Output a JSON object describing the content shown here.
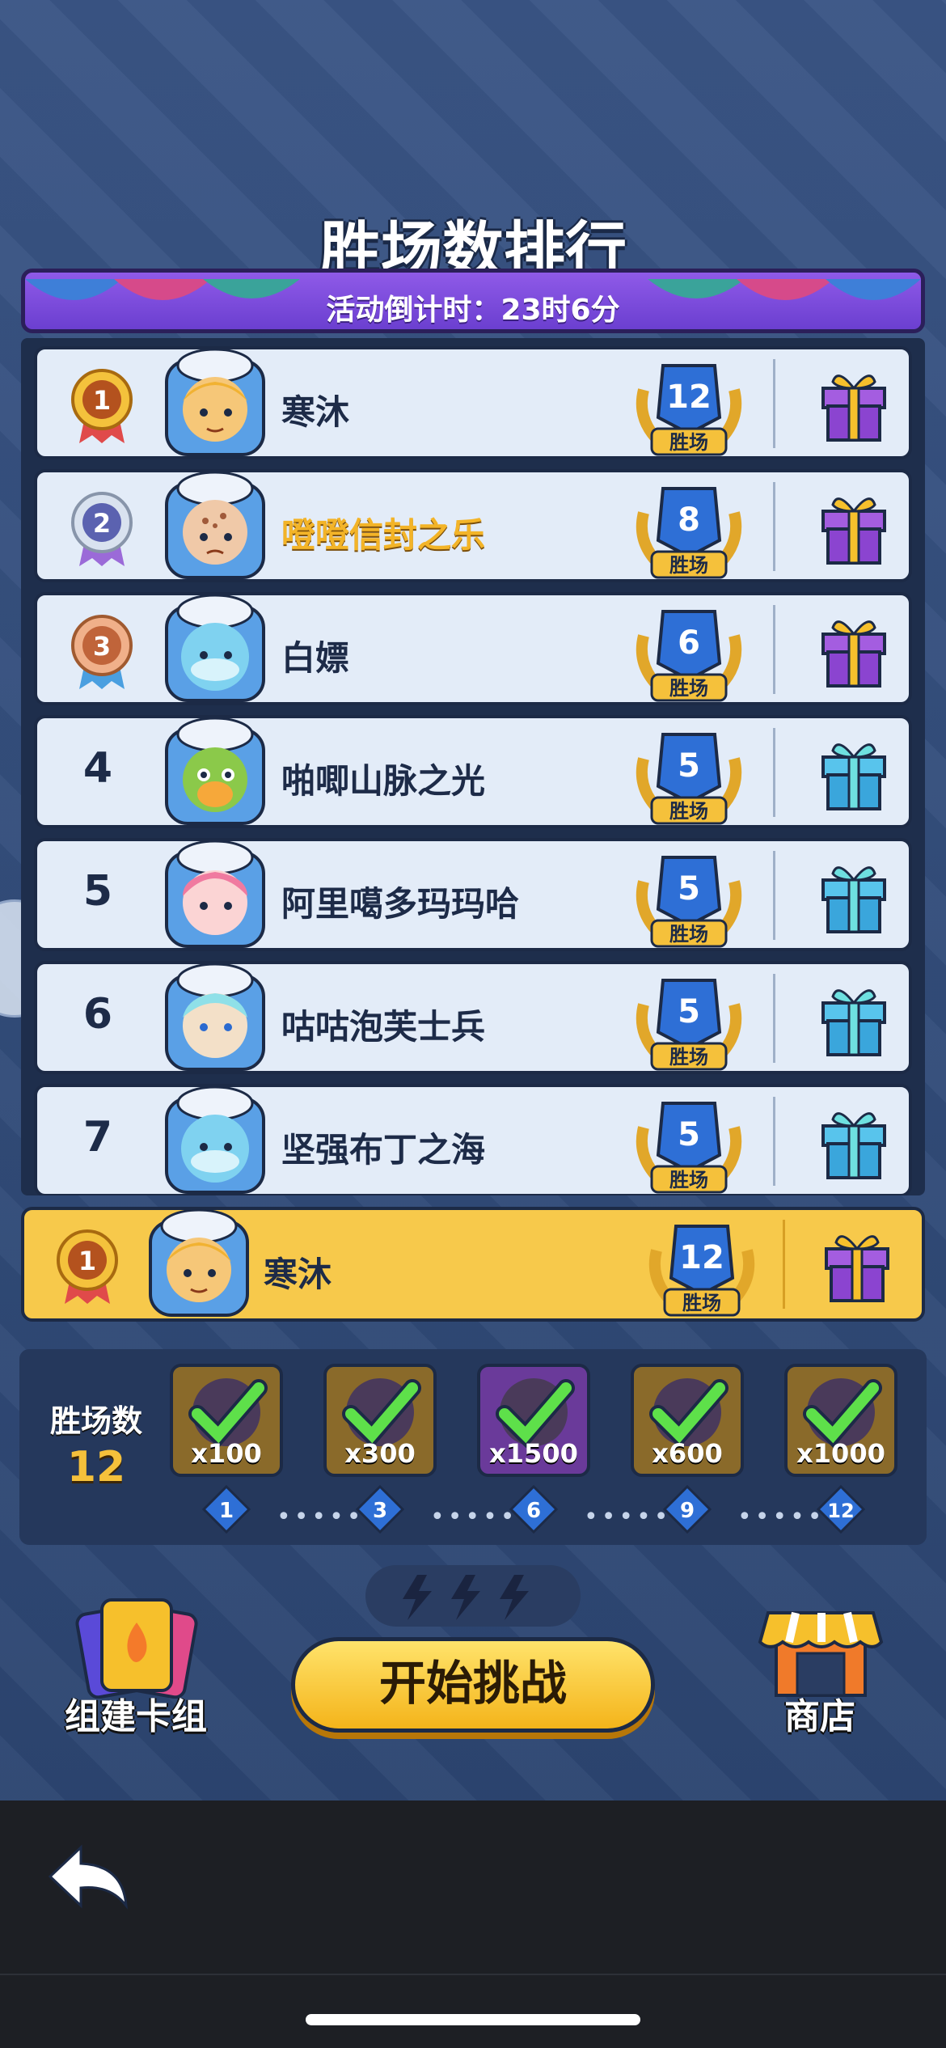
{
  "title": "胜场数排行",
  "countdown": "活动倒计时：23时6分",
  "wins_unit": "胜场",
  "rows": [
    {
      "rank": "1",
      "name": "寒沐",
      "wins": "12",
      "highlight": false
    },
    {
      "rank": "2",
      "name": "噔噔信封之乐",
      "wins": "8",
      "highlight": true
    },
    {
      "rank": "3",
      "name": "白嫖",
      "wins": "6",
      "highlight": false
    },
    {
      "rank": "4",
      "name": "啪唧山脉之光",
      "wins": "5",
      "highlight": false
    },
    {
      "rank": "5",
      "name": "阿里噶多玛玛哈",
      "wins": "5",
      "highlight": false
    },
    {
      "rank": "6",
      "name": "咕咕泡芙士兵",
      "wins": "5",
      "highlight": false
    },
    {
      "rank": "7",
      "name": "坚强布丁之海",
      "wins": "5",
      "highlight": false
    }
  ],
  "me": {
    "rank": "1",
    "name": "寒沐",
    "wins": "12"
  },
  "rewards": {
    "label": "胜场数",
    "count": "12",
    "items": [
      {
        "qty": "x100",
        "milestone": "1"
      },
      {
        "qty": "x300",
        "milestone": "3"
      },
      {
        "qty": "x1500",
        "milestone": "6"
      },
      {
        "qty": "x600",
        "milestone": "9"
      },
      {
        "qty": "x1000",
        "milestone": "12"
      }
    ]
  },
  "buttons": {
    "deck": "组建卡组",
    "start": "开始挑战",
    "shop": "商店"
  },
  "colors": {
    "accent": "#f7c94b",
    "banner": "#7a4ad8",
    "background": "#2f4a76"
  }
}
